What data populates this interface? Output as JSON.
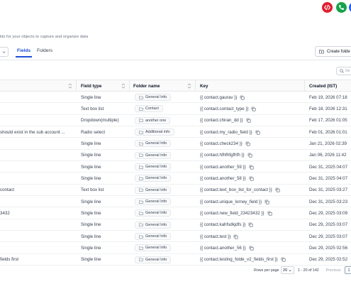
{
  "header": {
    "code_button_icon": "code-icon",
    "phone_button_icon": "phone-icon",
    "colors": {
      "code": "#e11d2e",
      "phone": "#16a34a",
      "blue": "#2563eb"
    }
  },
  "page": {
    "subtitle": "lds for your objects to capture and organize data"
  },
  "tabs": {
    "fields": "Fields",
    "folders": "Folders"
  },
  "actions": {
    "create_folder": "Create folde"
  },
  "search": {
    "placeholder": "Se"
  },
  "table": {
    "headers": {
      "field_type": "Field type",
      "folder_name": "Folder name",
      "key": "Key",
      "created": "Created (IST)"
    },
    "rows": [
      {
        "name": "",
        "type": "Single line",
        "folder": "General Info",
        "key": "{{ contact.gaurav }}",
        "created": "Feb 19, 2026 07:18"
      },
      {
        "name": "",
        "type": "Text box list",
        "folder": "Contact",
        "key": "{{ contact.contact_type }}",
        "created": "Feb 18, 2026 12:31"
      },
      {
        "name": "",
        "type": "Dropdown(multiple)",
        "folder": "another one",
        "key": "{{ contact.chiran_dd }}",
        "created": "Feb 17, 2026 01:05"
      },
      {
        "name": "should exist in the sub account ...",
        "type": "Radio select",
        "folder": "Additional info",
        "key": "{{ contact.my_radio_field }}",
        "created": "Feb 01, 2026 01:01"
      },
      {
        "name": "",
        "type": "Single line",
        "folder": "General Info",
        "key": "{{ contact.check234 }}",
        "created": "Jan 21, 2026 02:39"
      },
      {
        "name": "",
        "type": "Single line",
        "folder": "General Info",
        "key": "{{ contact.hfhfhfgfhfh }}",
        "created": "Jan 06, 2026 11:42"
      },
      {
        "name": "",
        "type": "Single line",
        "folder": "General Info",
        "key": "{{ contact.another_59 }}",
        "created": "Dec 31, 2025 04:07"
      },
      {
        "name": "",
        "type": "Single line",
        "folder": "General Info",
        "key": "{{ contact.another_58 }}",
        "created": "Dec 31, 2025 04:07"
      },
      {
        "name": "contact",
        "type": "Text box list",
        "folder": "General Info",
        "key": "{{ contact.text_box_list_for_contact }}",
        "created": "Dec 31, 2025 03:27"
      },
      {
        "name": "",
        "type": "Single line",
        "folder": "General Info",
        "key": "{{ contact.unique_lorney_field }}",
        "created": "Dec 31, 2025 03:23"
      },
      {
        "name": "3432",
        "type": "Single line",
        "folder": "General Info",
        "key": "{{ contact.new_field_23423432 }}",
        "created": "Dec 29, 2025 03:09"
      },
      {
        "name": "",
        "type": "Single line",
        "folder": "General Info",
        "key": "{{ contact.kahfsdkjdfs }}",
        "created": "Dec 29, 2025 03:07"
      },
      {
        "name": "",
        "type": "Single line",
        "folder": "General Info",
        "key": "{{ contact.test }}",
        "created": "Dec 29, 2025 03:07"
      },
      {
        "name": "",
        "type": "Single line",
        "folder": "General Info",
        "key": "{{ contact.another_56 }}",
        "created": "Dec 29, 2025 02:56"
      },
      {
        "name": "fields first",
        "type": "Single line",
        "folder": "General Info",
        "key": "{{ contact.testing_folde_v2_fields_first }}",
        "created": "Dec 29, 2025 02:52"
      }
    ]
  },
  "pagination": {
    "rows_per_page_label": "Rows per page",
    "rows_per_page": "20",
    "range": "1 - 20 of 142",
    "previous": "Previous",
    "current_page": "1"
  }
}
